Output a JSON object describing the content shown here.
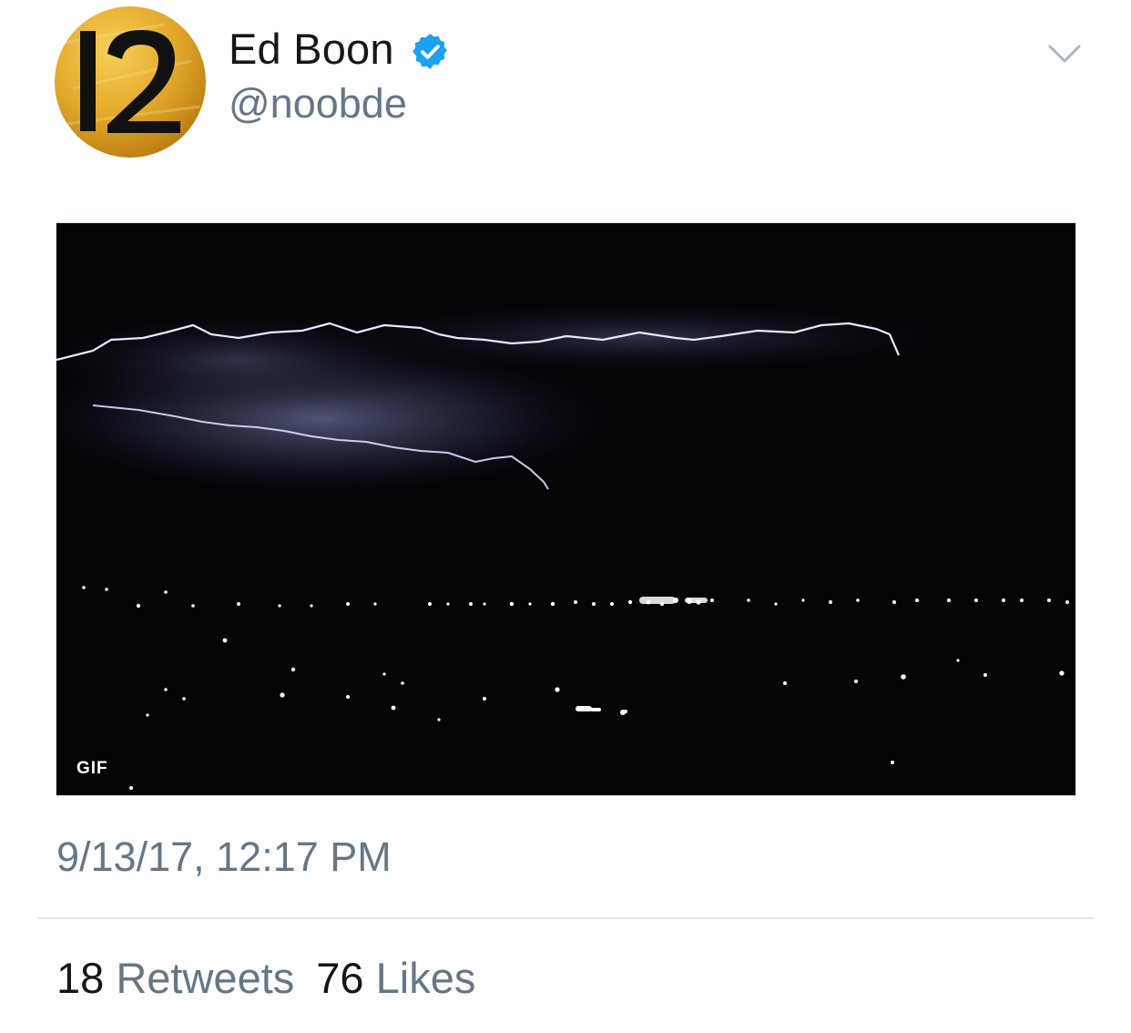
{
  "tweet": {
    "author": {
      "display_name": "Ed Boon",
      "handle": "@noobde",
      "verified": true,
      "avatar_text": "12"
    },
    "media": {
      "type": "GIF",
      "badge_label": "GIF"
    },
    "timestamp": "9/13/17, 12:17 PM",
    "stats": {
      "retweets_count": "18",
      "retweets_label": "Retweets",
      "likes_count": "76",
      "likes_label": "Likes"
    }
  },
  "colors": {
    "verified_blue": "#1da1f2",
    "secondary_text": "#657786",
    "primary_text": "#14171a",
    "divider": "#e1e8ed"
  },
  "icons": {
    "verified": "verified-badge-icon",
    "caret": "chevron-down-icon"
  }
}
